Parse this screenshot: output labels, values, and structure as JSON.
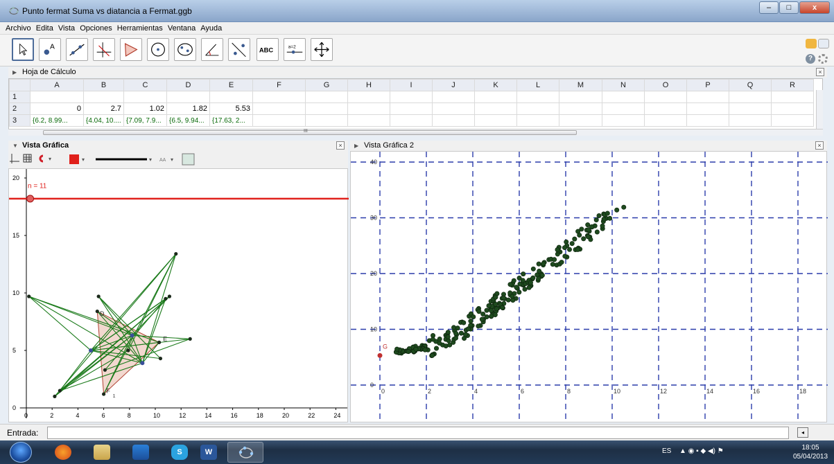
{
  "window": {
    "title": "Punto fermat Suma vs diatancia a Fermat.ggb",
    "buttons": [
      "minimize",
      "maximize",
      "close"
    ],
    "close_glyph": "x"
  },
  "menu": [
    "Archivo",
    "Edita",
    "Vista",
    "Opciones",
    "Herramientas",
    "Ventana",
    "Ayuda"
  ],
  "toolbar": {
    "tools": [
      {
        "name": "move-tool-icon"
      },
      {
        "name": "point-tool-icon"
      },
      {
        "name": "line-tool-icon"
      },
      {
        "name": "perpendicular-tool-icon"
      },
      {
        "name": "polygon-tool-icon"
      },
      {
        "name": "circle-tool-icon"
      },
      {
        "name": "ellipse-tool-icon"
      },
      {
        "name": "angle-tool-icon"
      },
      {
        "name": "reflect-tool-icon"
      },
      {
        "name": "text-tool-icon",
        "label": "ABC"
      },
      {
        "name": "slider-tool-icon",
        "label": "a=2"
      },
      {
        "name": "move-view-tool-icon"
      }
    ]
  },
  "spreadsheet": {
    "title": "Hoja de Cálculo",
    "columns": [
      "A",
      "B",
      "C",
      "D",
      "E",
      "F",
      "G",
      "H",
      "I",
      "J",
      "K",
      "L",
      "M",
      "N",
      "O",
      "P",
      "Q",
      "R"
    ],
    "rows": [
      {
        "header": "1",
        "cells": [
          "",
          "",
          "",
          "",
          ""
        ]
      },
      {
        "header": "2",
        "cells": [
          "0",
          "2.7",
          "1.02",
          "1.82",
          "5.53"
        ]
      },
      {
        "header": "3",
        "cells": [
          "{6.2, 8.99...",
          "{4.04, 10....",
          "{7.09, 7.9...",
          "{6.5, 9.94...",
          "{17.63, 2..."
        ]
      }
    ],
    "scroll_marker": "III"
  },
  "graphics1": {
    "title": "Vista Gráfica",
    "slider_label": "n = 11",
    "slider_value": 11,
    "x_ticks": [
      0,
      2,
      4,
      6,
      8,
      10,
      12,
      14,
      16,
      18,
      20,
      22,
      24
    ],
    "y_ticks": [
      0,
      5,
      10,
      15,
      20
    ],
    "point_labels": [
      "D",
      "E",
      "F",
      "1"
    ],
    "accent_line": "#e0201b",
    "segment_color": "#1a7a1a",
    "fill_color": "#e8b8a8"
  },
  "graphics2": {
    "title": "Vista Gráfica 2",
    "point_label": "G",
    "x_ticks": [
      0,
      2,
      4,
      6,
      8,
      10,
      12,
      14,
      16,
      18
    ],
    "y_ticks": [
      0,
      10,
      20,
      30,
      40
    ],
    "grid_color": "#2a3caa",
    "point_color": "#1e4a1e"
  },
  "input_bar": {
    "label": "Entrada:"
  },
  "taskbar": {
    "apps": [
      "firefox",
      "explorer",
      "media-player",
      "skype",
      "word",
      "geogebra"
    ],
    "language": "ES",
    "time": "18:05",
    "date": "05/04/2013"
  }
}
